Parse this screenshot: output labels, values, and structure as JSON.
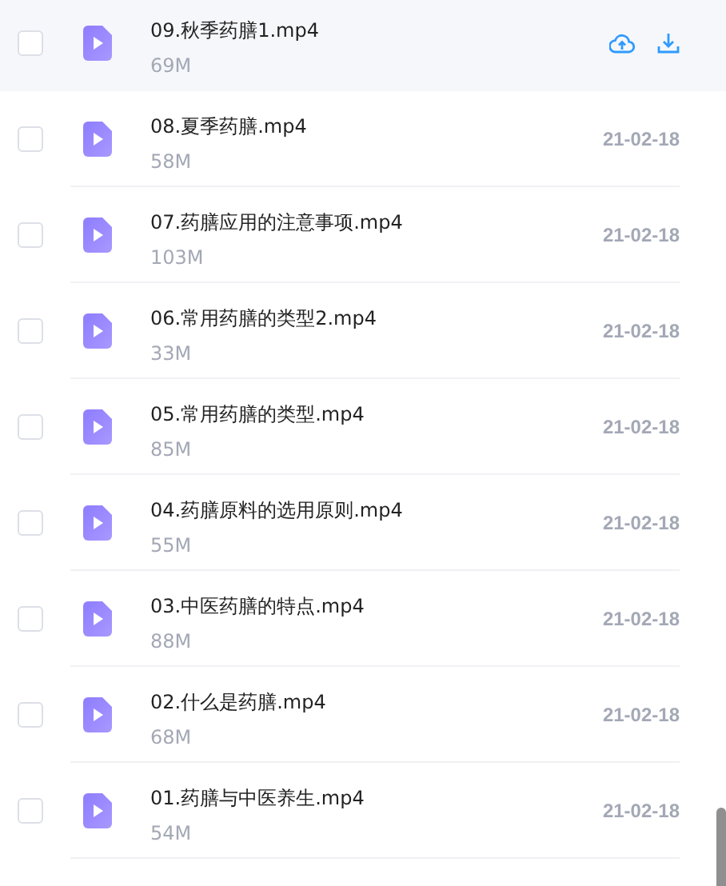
{
  "files": [
    {
      "name": "09.秋季药膳1.mp4",
      "size": "69M",
      "checked": false,
      "hovered": true
    },
    {
      "name": "08.夏季药膳.mp4",
      "size": "58M",
      "date": "21-02-18",
      "checked": false,
      "hovered": false
    },
    {
      "name": "07.药膳应用的注意事项.mp4",
      "size": "103M",
      "date": "21-02-18",
      "checked": false,
      "hovered": false
    },
    {
      "name": "06.常用药膳的类型2.mp4",
      "size": "33M",
      "date": "21-02-18",
      "checked": false,
      "hovered": false
    },
    {
      "name": "05.常用药膳的类型.mp4",
      "size": "85M",
      "date": "21-02-18",
      "checked": false,
      "hovered": false
    },
    {
      "name": "04.药膳原料的选用原则.mp4",
      "size": "55M",
      "date": "21-02-18",
      "checked": false,
      "hovered": false
    },
    {
      "name": "03.中医药膳的特点.mp4",
      "size": "88M",
      "date": "21-02-18",
      "checked": false,
      "hovered": false
    },
    {
      "name": "02.什么是药膳.mp4",
      "size": "68M",
      "date": "21-02-18",
      "checked": false,
      "hovered": false
    },
    {
      "name": "01.药膳与中医养生.mp4",
      "size": "54M",
      "date": "21-02-18",
      "checked": false,
      "hovered": false
    }
  ]
}
